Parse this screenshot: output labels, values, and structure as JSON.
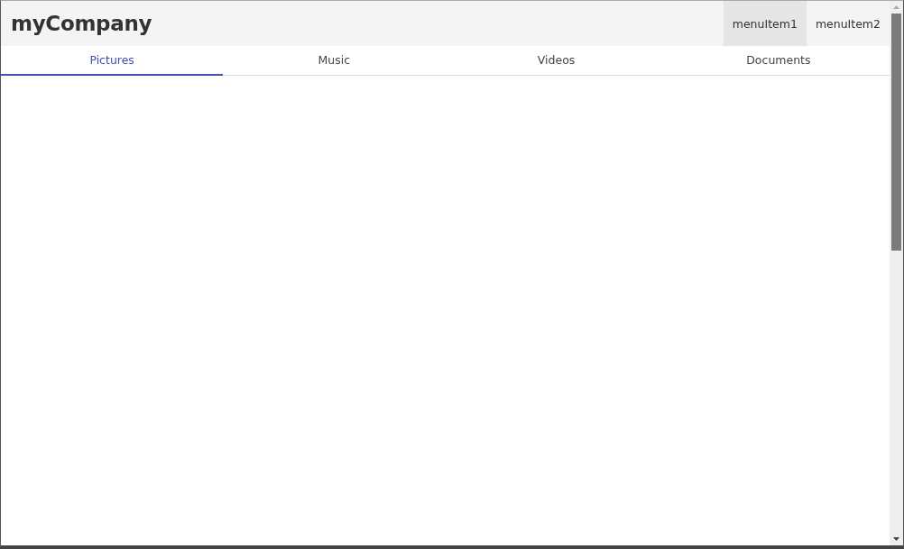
{
  "header": {
    "brand": "myCompany",
    "menu": [
      {
        "label": "menuItem1",
        "selected": true
      },
      {
        "label": "menuItem2",
        "selected": false
      }
    ]
  },
  "tabs": [
    {
      "label": "Pictures",
      "selected": true
    },
    {
      "label": "Music",
      "selected": false
    },
    {
      "label": "Videos",
      "selected": false
    },
    {
      "label": "Documents",
      "selected": false
    }
  ]
}
